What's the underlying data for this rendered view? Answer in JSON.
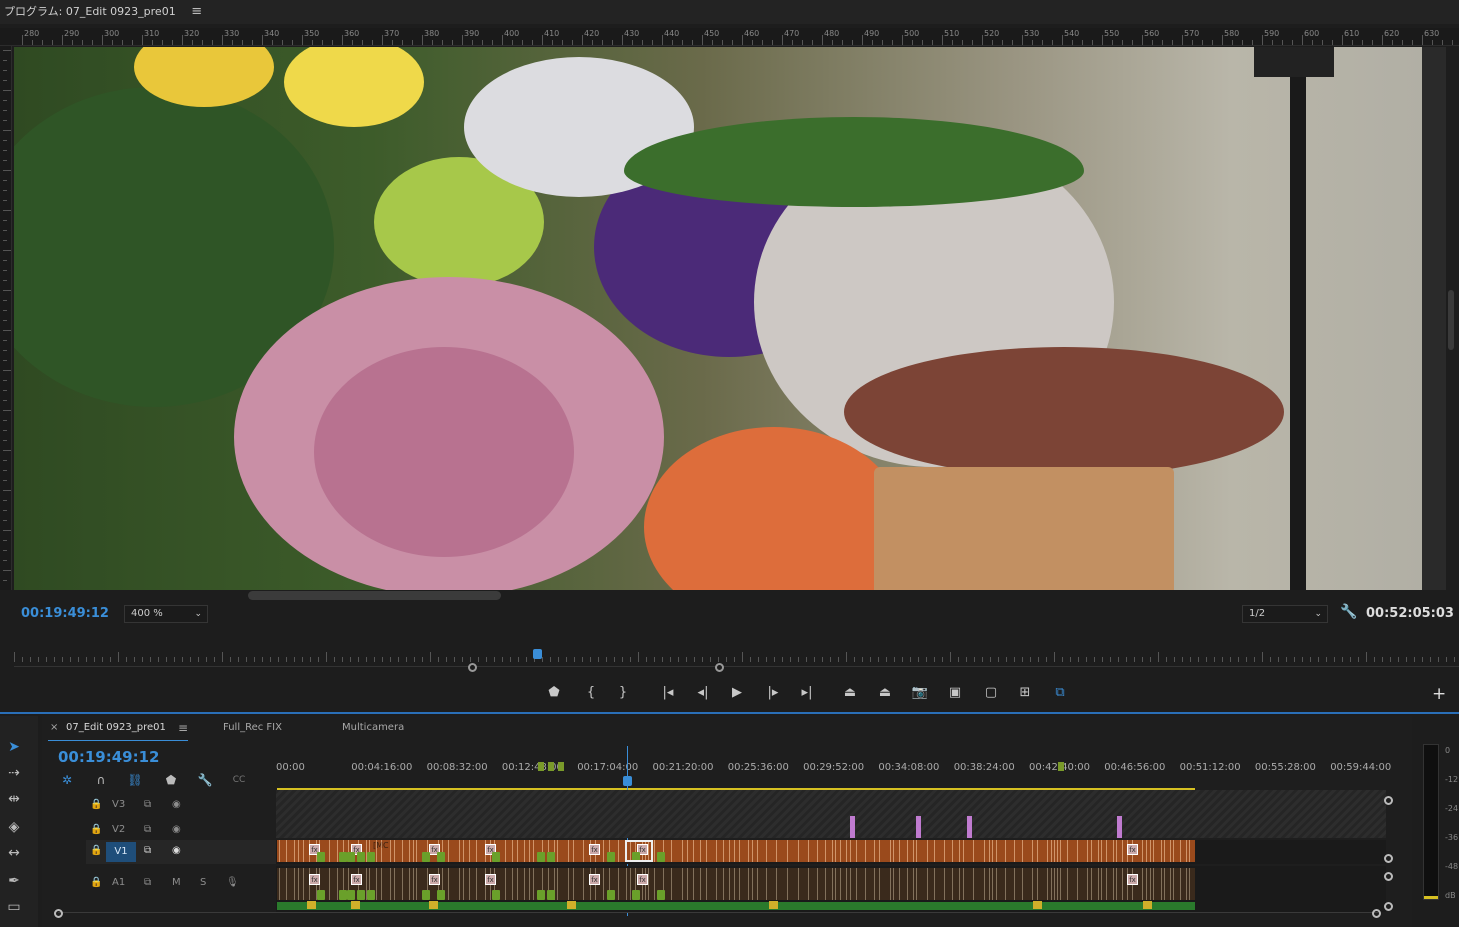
{
  "monitor": {
    "title": "プログラム: 07_Edit 0923_pre01",
    "menu_icon": "hamburger-icon",
    "ruler_labels": [
      "280",
      "290",
      "300",
      "310",
      "320",
      "330",
      "340",
      "350",
      "360",
      "370",
      "380",
      "390",
      "400",
      "410",
      "420",
      "430",
      "440",
      "450",
      "460",
      "470",
      "480",
      "490",
      "500",
      "510",
      "520",
      "530",
      "540",
      "550",
      "560",
      "570",
      "580",
      "590",
      "600",
      "610",
      "620",
      "630"
    ],
    "current_timecode": "00:19:49:12",
    "zoom": "400 %",
    "resolution": "1/2",
    "duration": "00:52:05:03"
  },
  "transport": {
    "buttons": [
      {
        "name": "marker-button",
        "icon": "marker-icon",
        "glyph": "⬟"
      },
      {
        "name": "mark-in-button",
        "icon": "mark-in-icon",
        "glyph": "{"
      },
      {
        "name": "mark-out-button",
        "icon": "mark-out-icon",
        "glyph": "}"
      },
      {
        "name": "go-to-in-button",
        "icon": "go-to-in-icon",
        "glyph": "|◂"
      },
      {
        "name": "step-back-button",
        "icon": "step-back-icon",
        "glyph": "◂|"
      },
      {
        "name": "play-button",
        "icon": "play-icon",
        "glyph": "▶"
      },
      {
        "name": "step-forward-button",
        "icon": "step-forward-icon",
        "glyph": "|▸"
      },
      {
        "name": "go-to-out-button",
        "icon": "go-to-out-icon",
        "glyph": "▸|"
      },
      {
        "name": "lift-button",
        "icon": "lift-icon",
        "glyph": "⏏"
      },
      {
        "name": "extract-button",
        "icon": "extract-icon",
        "glyph": "⏏"
      },
      {
        "name": "export-frame-button",
        "icon": "camera-icon",
        "glyph": "📷"
      },
      {
        "name": "comparison-view-button",
        "icon": "comparison-icon",
        "glyph": "▣"
      },
      {
        "name": "safe-margins-button",
        "icon": "safe-margins-icon",
        "glyph": "▢"
      },
      {
        "name": "multicam-button",
        "icon": "multicam-icon",
        "glyph": "⊞"
      },
      {
        "name": "vr-video-button",
        "icon": "vr-icon",
        "glyph": "⧉"
      }
    ],
    "add_icon": "plus-icon"
  },
  "tools": [
    "selection-tool-icon",
    "track-select-tool-icon",
    "ripple-edit-tool-icon",
    "razor-tool-icon",
    "slip-tool-icon",
    "pen-tool-icon",
    "rectangle-tool-icon"
  ],
  "timeline": {
    "tabs": [
      {
        "label": "07_Edit 0923_pre01",
        "active": true
      },
      {
        "label": "Full_Rec FIX",
        "active": false
      },
      {
        "label": "Multicamera",
        "active": false
      }
    ],
    "close_glyph": "×",
    "menu_glyph": "≡",
    "timecode": "00:19:49:12",
    "ruler_labels": [
      "00:00",
      "00:04:16:00",
      "00:08:32:00",
      "00:12:48:00",
      "00:17:04:00",
      "00:21:20:00",
      "00:25:36:00",
      "00:29:52:00",
      "00:34:08:00",
      "00:38:24:00",
      "00:42:40:00",
      "00:46:56:00",
      "00:51:12:00",
      "00:55:28:00",
      "00:59:44:00"
    ],
    "tracks": [
      {
        "label": "V3",
        "kind": "video"
      },
      {
        "label": "V2",
        "kind": "video"
      },
      {
        "label": "V1",
        "kind": "video",
        "targeted": true
      },
      {
        "label": "A1",
        "kind": "audio",
        "mute": "M",
        "solo": "S"
      }
    ],
    "clip_label": "[MC"
  },
  "meter": {
    "scale": [
      "0",
      "-12",
      "-24",
      "-36",
      "-48",
      "dB"
    ]
  }
}
